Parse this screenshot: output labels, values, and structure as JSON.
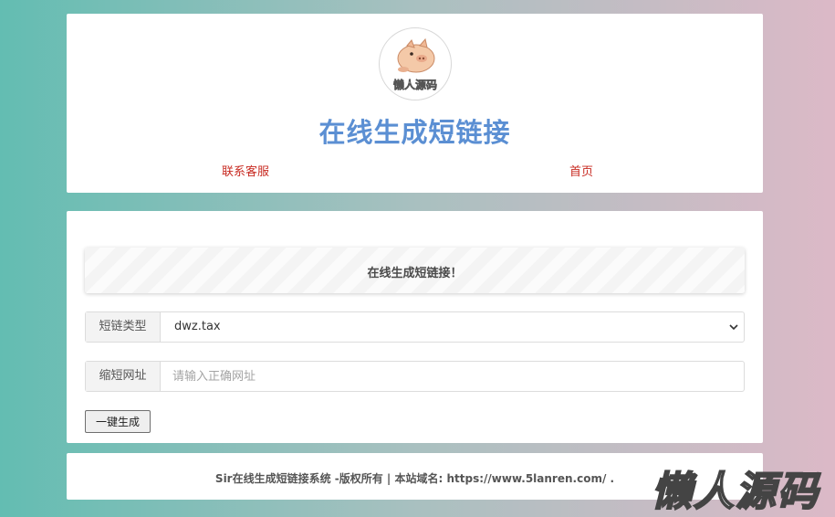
{
  "header": {
    "logo_text": "懒人源码",
    "title": "在线生成短链接",
    "nav": [
      {
        "label": "联系客服"
      },
      {
        "label": "首页"
      }
    ],
    "colors": {
      "title": "#5b8fd3",
      "nav": "#c82b22"
    }
  },
  "main": {
    "notice": "在线生成短链接！",
    "type_field": {
      "label": "短链类型",
      "value": "dwz.tax"
    },
    "url_field": {
      "label": "缩短网址",
      "value": "",
      "placeholder": "请输入正确网址"
    },
    "submit_label": "一键生成"
  },
  "footer": {
    "text": "Sir在线生成短链接系统 -版权所有 | 本站域名: https://www.5lanren.com/ ."
  },
  "watermark": "懒人源码"
}
